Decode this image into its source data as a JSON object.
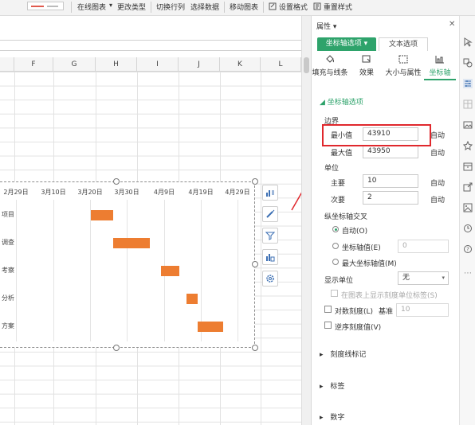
{
  "ribbon": {
    "items": [
      "在线图表",
      "更改类型",
      "切换行列",
      "选择数据",
      "移动图表",
      "设置格式",
      "重置样式"
    ]
  },
  "sheet": {
    "columns": [
      "F",
      "G",
      "H",
      "I",
      "J",
      "K",
      "L"
    ]
  },
  "chart": {
    "x_ticks": [
      "2月29日",
      "3月10日",
      "3月20日",
      "3月30日",
      "4月9日",
      "4月19日",
      "4月29日"
    ],
    "category_labels": [
      "项目",
      "调查",
      "考察",
      "分析",
      "方案"
    ]
  },
  "chart_data": {
    "type": "bar",
    "orientation": "horizontal",
    "x_ticks": [
      "2月29日",
      "3月10日",
      "3月20日",
      "3月30日",
      "4月9日",
      "4月19日",
      "4月29日"
    ],
    "categories": [
      "项目",
      "调查",
      "考察",
      "分析",
      "方案"
    ],
    "series": [
      {
        "start_dates": [
          "3月20日",
          "3月26日",
          "4月9日",
          "4月17日",
          "4月20日"
        ],
        "durations_days": [
          6,
          10,
          5,
          3,
          7
        ],
        "color": "#ed7d31"
      }
    ],
    "xlim": [
      "2月29日",
      "5月1日"
    ],
    "grid": true
  },
  "panel": {
    "title": "属性",
    "tabs": [
      "坐标轴选项",
      "文本选项"
    ],
    "subtabs": [
      "填充与线条",
      "效果",
      "大小与属性",
      "坐标轴"
    ],
    "section_title": "坐标轴选项",
    "bounds_label": "边界",
    "min_label": "最小值",
    "min_value": "43910",
    "max_label": "最大值",
    "max_value": "43950",
    "auto_label": "自动",
    "units_label": "单位",
    "major_label": "主要",
    "major_value": "10",
    "minor_label": "次要",
    "minor_value": "2",
    "cross_label": "纵坐标轴交叉",
    "cross_auto": "自动(O)",
    "cross_value_label": "坐标轴值(E)",
    "cross_value": "0",
    "cross_max": "最大坐标轴值(M)",
    "display_unit_label": "显示单位",
    "display_unit_value": "无",
    "show_unit_label": "在图表上显示刻度单位标签(S)",
    "log_label": "对数刻度(L)",
    "base_label": "基准",
    "base_value": "10",
    "reverse_label": "逆序刻度值(V)",
    "collapsed": [
      "刻度线标记",
      "标签",
      "数字"
    ]
  },
  "colors": {
    "accent": "#2ea36b",
    "bar": "#ed7d31",
    "highlight": "#e0282d"
  }
}
